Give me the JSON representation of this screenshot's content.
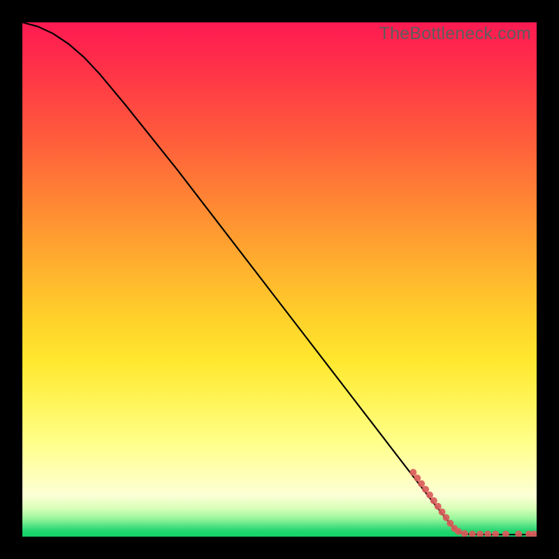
{
  "watermark": "TheBottleneck.com",
  "colors": {
    "background": "#000000",
    "curve": "#000000",
    "marker": "#da5b5b",
    "gradient_stops": [
      "#ff1a52",
      "#ff5a3c",
      "#ffb22e",
      "#ffe82f",
      "#ffff8c",
      "#d9ffb8",
      "#1fd56e"
    ]
  },
  "chart_data": {
    "type": "line",
    "title": "",
    "xlabel": "",
    "ylabel": "",
    "xlim": [
      0,
      100
    ],
    "ylim": [
      0,
      100
    ],
    "grid": false,
    "curve_points": [
      {
        "x": 0,
        "y": 100
      },
      {
        "x": 3,
        "y": 99.2
      },
      {
        "x": 6,
        "y": 97.8
      },
      {
        "x": 9,
        "y": 95.8
      },
      {
        "x": 12,
        "y": 93.2
      },
      {
        "x": 15,
        "y": 90.0
      },
      {
        "x": 20,
        "y": 84.0
      },
      {
        "x": 30,
        "y": 71.5
      },
      {
        "x": 40,
        "y": 58.5
      },
      {
        "x": 50,
        "y": 45.5
      },
      {
        "x": 60,
        "y": 32.5
      },
      {
        "x": 70,
        "y": 19.5
      },
      {
        "x": 75,
        "y": 13.0
      },
      {
        "x": 80,
        "y": 6.5
      },
      {
        "x": 84,
        "y": 1.5
      },
      {
        "x": 85,
        "y": 0.8
      },
      {
        "x": 86,
        "y": 0.5
      },
      {
        "x": 90,
        "y": 0.4
      },
      {
        "x": 95,
        "y": 0.4
      },
      {
        "x": 100,
        "y": 0.4
      }
    ],
    "marker_clusters": [
      {
        "x": 76.0,
        "y": 12.5,
        "r": 5
      },
      {
        "x": 76.8,
        "y": 11.4,
        "r": 5
      },
      {
        "x": 77.6,
        "y": 10.3,
        "r": 5
      },
      {
        "x": 78.4,
        "y": 9.2,
        "r": 5
      },
      {
        "x": 79.2,
        "y": 8.1,
        "r": 5
      },
      {
        "x": 80.0,
        "y": 7.0,
        "r": 5
      },
      {
        "x": 80.8,
        "y": 5.9,
        "r": 5
      },
      {
        "x": 81.6,
        "y": 4.8,
        "r": 5
      },
      {
        "x": 82.4,
        "y": 3.7,
        "r": 5
      },
      {
        "x": 83.2,
        "y": 2.6,
        "r": 5
      },
      {
        "x": 84.0,
        "y": 1.6,
        "r": 5
      },
      {
        "x": 84.8,
        "y": 1.0,
        "r": 5
      },
      {
        "x": 86.0,
        "y": 0.6,
        "r": 5
      },
      {
        "x": 87.5,
        "y": 0.5,
        "r": 5
      },
      {
        "x": 89.0,
        "y": 0.5,
        "r": 5
      },
      {
        "x": 90.5,
        "y": 0.5,
        "r": 5
      },
      {
        "x": 92.0,
        "y": 0.5,
        "r": 5
      },
      {
        "x": 94.0,
        "y": 0.5,
        "r": 5
      },
      {
        "x": 96.5,
        "y": 0.5,
        "r": 5
      },
      {
        "x": 98.5,
        "y": 0.5,
        "r": 5
      },
      {
        "x": 99.5,
        "y": 0.5,
        "r": 5
      }
    ]
  }
}
